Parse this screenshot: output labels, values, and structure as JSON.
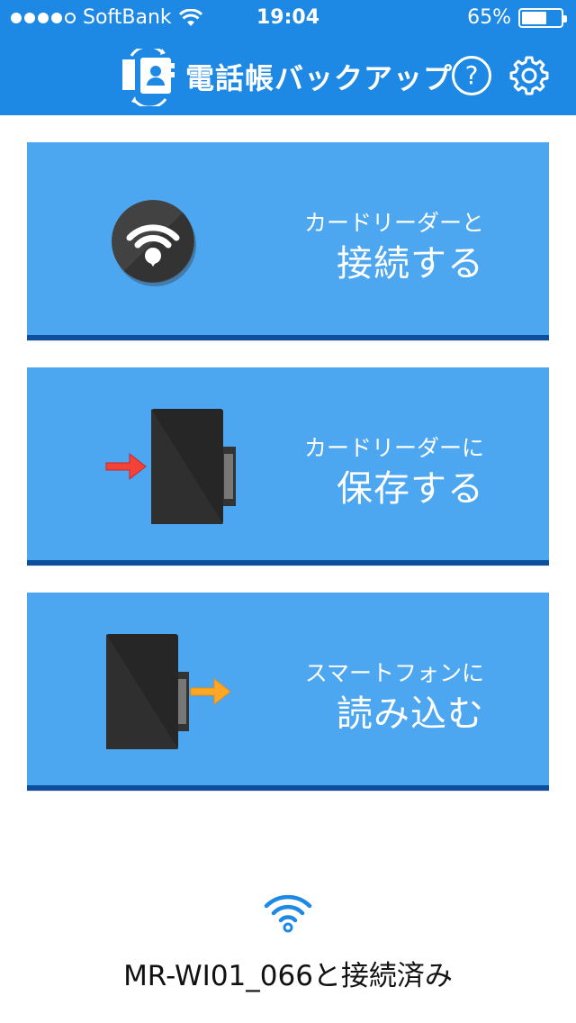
{
  "status_bar": {
    "carrier": "SoftBank",
    "time": "19:04",
    "battery_percent": "65%",
    "battery_level": 0.65,
    "signal_bars": 4,
    "signal_total": 5
  },
  "navbar": {
    "title": "電話帳バックアップ",
    "help_label": "?",
    "icons": {
      "logo": "contact-backup-logo-icon",
      "help": "help-icon",
      "settings": "gear-icon"
    }
  },
  "actions": [
    {
      "line1": "カードリーダーと",
      "line2": "接続する",
      "icon": "wifi-connect-icon"
    },
    {
      "line1": "カードリーダーに",
      "line2": "保存する",
      "icon": "save-to-card-icon"
    },
    {
      "line1": "スマートフォンに",
      "line2": "読み込む",
      "icon": "load-from-card-icon"
    }
  ],
  "connection": {
    "status_text": "MR-WI01_066と接続済み",
    "icon": "wifi-icon"
  },
  "colors": {
    "primary": "#1e88e5",
    "card": "#4da6f0",
    "card_shadow": "#0d4f9c",
    "arrow_save": "#f44336",
    "arrow_load": "#ffa726"
  }
}
